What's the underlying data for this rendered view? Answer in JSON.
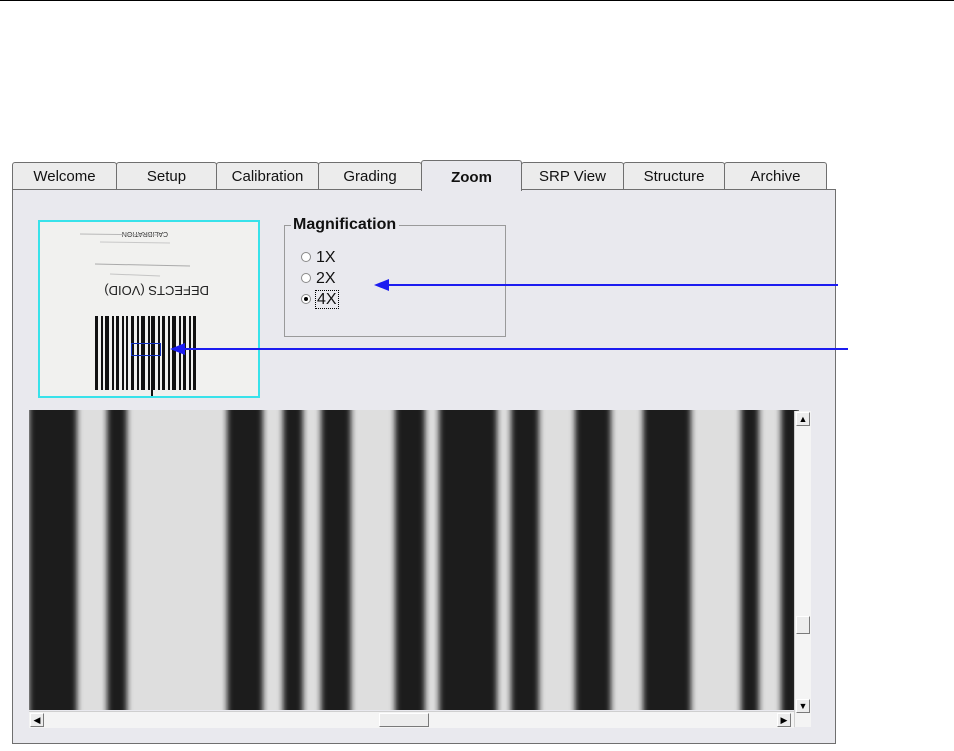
{
  "tabs": [
    "Welcome",
    "Setup",
    "Calibration",
    "Grading",
    "Zoom",
    "SRP View",
    "Structure",
    "Archive"
  ],
  "active_tab": "Zoom",
  "thumbnail": {
    "label_top": "CALIBRATION",
    "label_defects": "DEFECTS (VOID)"
  },
  "magnification": {
    "title": "Magnification",
    "options": [
      {
        "label": "1X",
        "selected": false
      },
      {
        "label": "2X",
        "selected": false
      },
      {
        "label": "4X",
        "selected": true
      }
    ]
  },
  "zoom_view": {
    "vertical_scroll_position": 0.72,
    "horizontal_scroll_position": 0.48
  },
  "colors": {
    "thumbnail_border": "#38e2ea",
    "annotation_arrow": "#1c1cf0",
    "selection_box": "#1030c0"
  },
  "icons": {
    "scroll_up": "arrow-up-icon",
    "scroll_down": "arrow-down-icon",
    "scroll_left": "arrow-left-icon",
    "scroll_right": "arrow-right-icon"
  }
}
